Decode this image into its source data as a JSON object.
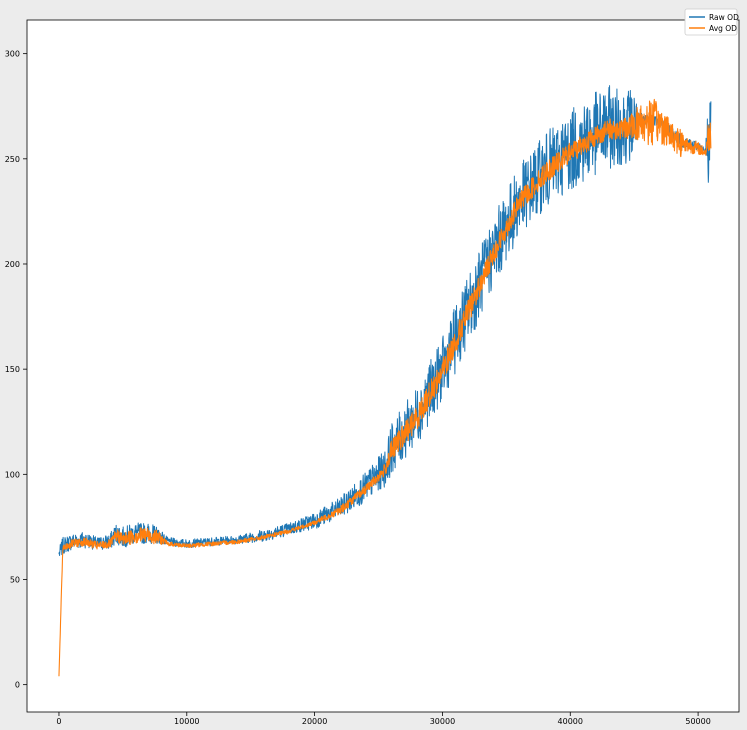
{
  "chart_data": {
    "type": "line",
    "title": "",
    "xlabel": "",
    "ylabel": "",
    "xlim": [
      -2500,
      53200
    ],
    "ylim": [
      -13,
      316
    ],
    "grid": false,
    "legend": "top-right",
    "xticks": [
      0,
      10000,
      20000,
      30000,
      40000,
      50000
    ],
    "xtick_labels": [
      "0",
      "10000",
      "20000",
      "30000",
      "40000",
      "50000"
    ],
    "yticks": [
      0,
      50,
      100,
      150,
      200,
      250,
      300
    ],
    "ytick_labels": [
      "0",
      "50",
      "100",
      "150",
      "200",
      "250",
      "300"
    ],
    "series": [
      {
        "name": "Raw OD",
        "color": "#1f77b4",
        "x": [
          0,
          300,
          1000,
          2000,
          3000,
          4000,
          4500,
          5000,
          6000,
          7000,
          7800,
          8500,
          10000,
          12000,
          14000,
          16000,
          18000,
          20000,
          22000,
          24000,
          25500,
          26000,
          28000,
          30000,
          32000,
          34000,
          35000,
          36000,
          38000,
          40000,
          41000,
          42000,
          43000,
          44000,
          45000,
          45300,
          46000,
          47000,
          48000,
          48600,
          49000,
          50000,
          50600,
          50800,
          51000
        ],
        "y": [
          62,
          66,
          68,
          69,
          67,
          68,
          72,
          70,
          72,
          72,
          71,
          68,
          67,
          68,
          69,
          71,
          74,
          78,
          84,
          94,
          103,
          112,
          128,
          150,
          178,
          206,
          218,
          230,
          244,
          254,
          258,
          262,
          265,
          265,
          267,
          268,
          269,
          268,
          262,
          259,
          258,
          256,
          254,
          262,
          265
        ],
        "spread": [
          3,
          4,
          4,
          4,
          3,
          4,
          5,
          5,
          5,
          5,
          4,
          2,
          2,
          2,
          2,
          3,
          3,
          4,
          5,
          7,
          9,
          12,
          14,
          15,
          17,
          17,
          17,
          17,
          18,
          19,
          20,
          20,
          20,
          18,
          18,
          4,
          3,
          3,
          3,
          3,
          3,
          2,
          2,
          25,
          25
        ]
      },
      {
        "name": "Avg OD",
        "color": "#ff7f0e",
        "x": [
          0,
          300,
          1000,
          2000,
          3000,
          4000,
          4500,
          5000,
          6000,
          7000,
          7800,
          8500,
          10000,
          12000,
          14000,
          16000,
          18000,
          20000,
          22000,
          24000,
          25500,
          26000,
          28000,
          30000,
          32000,
          34000,
          35000,
          36000,
          38000,
          40000,
          41000,
          42000,
          43000,
          44000,
          45000,
          45300,
          46000,
          47000,
          48000,
          48600,
          49000,
          50000,
          50600,
          50800,
          51000
        ],
        "y": [
          4,
          65,
          67,
          68,
          66,
          67,
          71,
          69,
          71,
          71,
          70,
          67,
          66,
          67,
          68,
          70,
          73,
          77,
          83,
          93,
          102,
          111,
          127,
          149,
          177,
          205,
          217,
          229,
          243,
          253,
          257,
          261,
          264,
          264,
          266,
          267,
          268,
          267,
          261,
          258,
          257,
          255,
          253,
          261,
          262
        ],
        "spread": [
          0,
          2,
          2,
          2,
          2,
          2,
          3,
          3,
          4,
          4,
          3,
          1,
          1,
          1,
          1,
          1,
          1,
          1,
          2,
          2,
          3,
          5,
          6,
          6,
          6,
          5,
          5,
          5,
          5,
          5,
          5,
          5,
          5,
          5,
          6,
          10,
          12,
          10,
          6,
          8,
          4,
          3,
          2,
          8,
          8
        ]
      }
    ]
  }
}
